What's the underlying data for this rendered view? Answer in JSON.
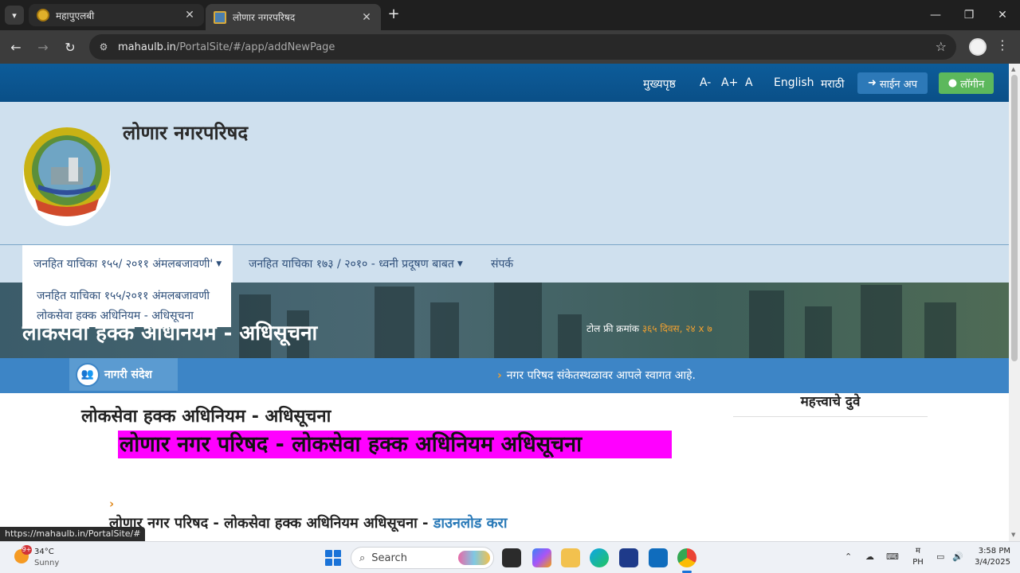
{
  "browser": {
    "tabs": [
      {
        "title": "महापुएलबी",
        "active": false
      },
      {
        "title": "लोणार नगरपरिषद",
        "active": true
      }
    ],
    "new_tab": "+",
    "url_host": "mahaulb.in",
    "url_path": "/PortalSite/#/app/addNewPage",
    "status_url": "https://mahaulb.in/PortalSite/#"
  },
  "topbar": {
    "home": "मुख्यपृष्ठ",
    "font_small": "A-",
    "font_large": "A+",
    "font_normal": "A",
    "lang_en": "English",
    "lang_mr": "मराठी",
    "signup": "साईन अप",
    "login": "लॉगीन"
  },
  "header": {
    "site_title": "लोणार नगरपरिषद",
    "logo_top_text": "नगर परिषद",
    "logo_bottom_text": "लोणार"
  },
  "menu": {
    "items": [
      {
        "label": "जनहित याचिका १५५/ २०११ अंमलबजावणी'",
        "open": true
      },
      {
        "label": "जनहित याचिका १७३ / २०१० - ध्वनी प्रदूषण बाबत",
        "open": false
      },
      {
        "label": "संपर्क",
        "open": false
      }
    ],
    "dropdown": [
      "जनहित याचिका १५५/२०११ अंमलबजावणी",
      "लोकसेवा हक्क अधिनियम - अधिसूचना"
    ]
  },
  "banner": {
    "title": "लोकसेवा हक्क अधिनियम - अधिसूचना",
    "toll_label": "टोल फ्री क्रमांक",
    "toll_number": "३६५ दिवस, २४ x ७"
  },
  "news": {
    "label": "नागरी संदेश",
    "text": "नगर परिषद संकेतस्थळावर आपले स्वागत आहे."
  },
  "content": {
    "title": "लोकसेवा हक्क अधिनियम - अधिसूचना",
    "highlight": "लोणार नगर परिषद  -  लोकसेवा हक्क अधिनियम अधिसूचना",
    "download_text": "लोणार नगर परिषद  -  लोकसेवा हक्क अधिनियम अधिसूचना - ",
    "download_link": "डाउनलोड करा"
  },
  "sidebar": {
    "title": "महत्त्वाचे दुवे"
  },
  "taskbar": {
    "weather_temp": "34°C",
    "weather_cond": "Sunny",
    "weather_badge": "9+",
    "search_placeholder": "Search",
    "lang_top": "म",
    "lang_bottom": "PH",
    "time": "3:58 PM",
    "date": "3/4/2025"
  },
  "colors": {
    "topbar": "#0d5c9a",
    "header_bg": "#cfe0ee",
    "newsbar": "#3d85c6",
    "highlight": "#ff00ff",
    "link": "#2a7ab8",
    "login_btn": "#5cb85c"
  }
}
